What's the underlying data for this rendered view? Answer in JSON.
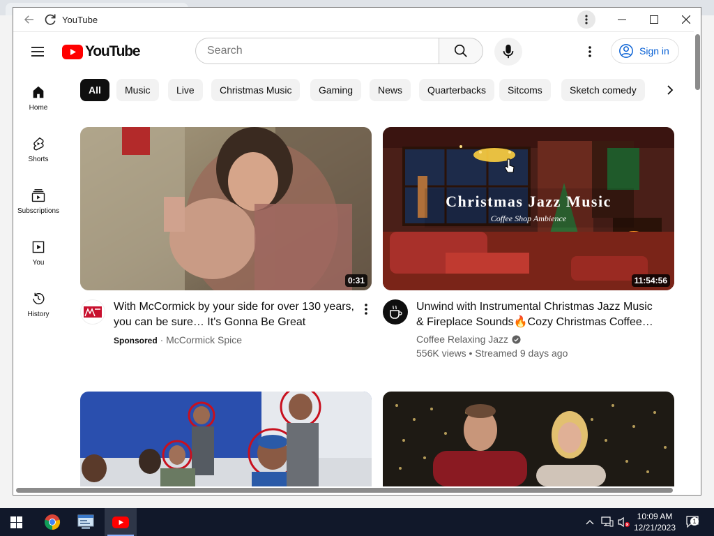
{
  "window": {
    "title": "YouTube"
  },
  "header": {
    "logo_text": "YouTube",
    "search_placeholder": "Search",
    "signin_label": "Sign in"
  },
  "sidebar": {
    "items": [
      {
        "label": "Home",
        "icon": "home-icon"
      },
      {
        "label": "Shorts",
        "icon": "shorts-icon"
      },
      {
        "label": "Subscriptions",
        "icon": "subscriptions-icon"
      },
      {
        "label": "You",
        "icon": "you-icon"
      },
      {
        "label": "History",
        "icon": "history-icon"
      }
    ]
  },
  "chips": [
    "All",
    "Music",
    "Live",
    "Christmas Music",
    "Gaming",
    "News",
    "Quarterbacks",
    "Sitcoms",
    "Sketch comedy"
  ],
  "videos": [
    {
      "title_line1": "With McCormick by your side for over 130 years,",
      "title_line2": "you can be sure… It's Gonna Be Great",
      "duration": "0:31",
      "sponsored": "Sponsored",
      "channel": "McCormick Spice",
      "separator": "·"
    },
    {
      "title_line1": "Unwind with Instrumental Christmas Jazz Music",
      "title_line2": "& Fireplace Sounds🔥Cozy Christmas Coffee…",
      "duration": "11:54:56",
      "thumb_title": "Christmas Jazz Music",
      "thumb_subtitle": "Coffee Shop Ambience",
      "channel": "Coffee Relaxing Jazz",
      "stats": "556K views • Streamed 9 days ago"
    }
  ],
  "taskbar": {
    "time": "10:09 AM",
    "date": "12/21/2023",
    "notification_count": "1"
  },
  "colors": {
    "youtube_red": "#ff0000",
    "signin_blue": "#065fd4",
    "taskbar": "#11182a"
  }
}
